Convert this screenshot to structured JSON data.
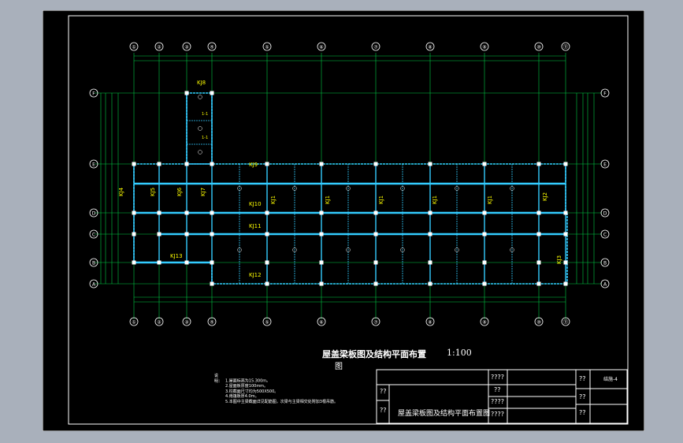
{
  "drawing": {
    "title": "屋盖梁板图及结构平面布置",
    "title_tail": "图",
    "scale": "1:100",
    "grid_x_top": [
      "①",
      "②",
      "③",
      "④",
      "⑤",
      "⑥",
      "⑦",
      "⑧",
      "⑨",
      "⑩",
      "⑪"
    ],
    "grid_x_bottom": [
      "①",
      "②",
      "③",
      "④",
      "⑤",
      "⑥",
      "⑦",
      "⑧",
      "⑨",
      "⑩",
      "⑪"
    ],
    "grid_y_left": [
      "F",
      "E",
      "D",
      "C",
      "B",
      "A"
    ],
    "grid_y_right": [
      "F",
      "E",
      "D",
      "C",
      "B",
      "A"
    ],
    "frame_labels": [
      "KJ8",
      "KJ9",
      "KJ4",
      "KJ5",
      "KJ6",
      "KJ7",
      "KJ10",
      "KJ1",
      "KJ1",
      "KJ1",
      "KJ1",
      "KJ1",
      "KJ2",
      "KJ11",
      "KJ13",
      "KJ12",
      "KJ3"
    ],
    "section_marks": [
      "1-1",
      "1-1"
    ]
  },
  "notes": {
    "heading": "说明：",
    "items": [
      "1.屋面标高为15.300m。",
      "2.屋面板厚度100mm。",
      "3.柱截面尺寸均为500X500。",
      "4.雨篷板厚4.0m。",
      "5.本图中主梁截面详见配筋图，次梁与主梁相交处附加3根吊筋。"
    ]
  },
  "title_block": {
    "left_top": "??",
    "left_mid": "??",
    "name": "屋盖梁板图及结构平面布置图",
    "r1": "????",
    "r2": "??",
    "r3": "????",
    "r4": "????",
    "c1": "??",
    "c2": "??",
    "c3": "??",
    "sheet_no": "结施-4"
  },
  "colors": {
    "background": "#000000",
    "wall": "#33ccff",
    "grid": "#00cc44",
    "text": "#ffffff",
    "label": "#ffff00",
    "outer": "#a9b0bb"
  }
}
